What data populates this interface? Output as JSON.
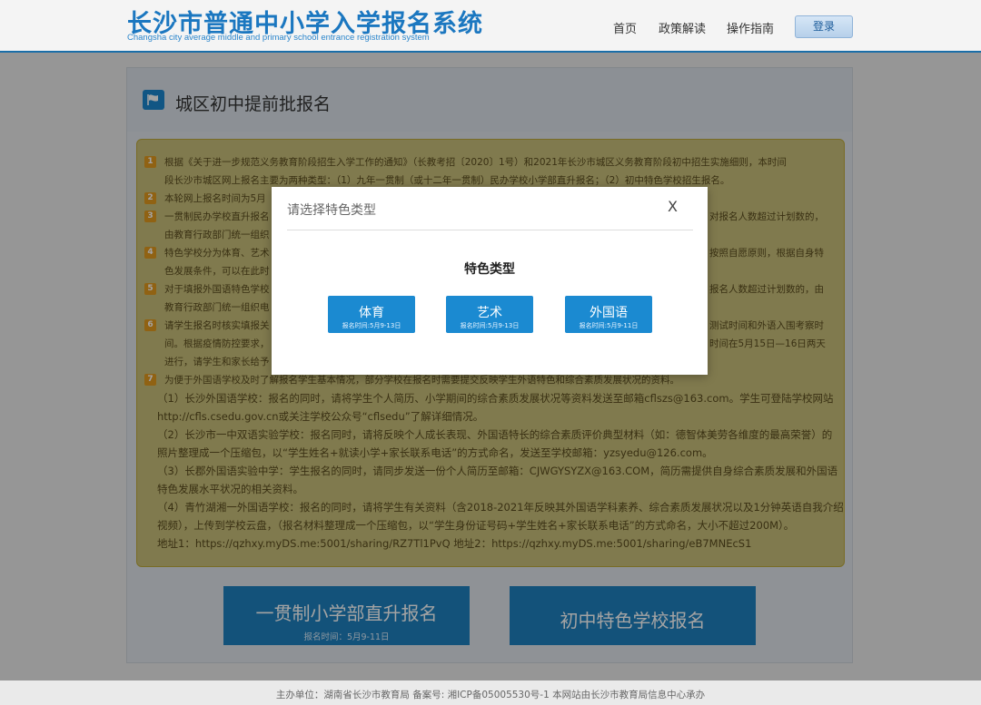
{
  "header": {
    "title": "长沙市普通中小学入学报名系统",
    "subtitle": "Changsha city average middle and primary school entrance registration system",
    "nav": [
      {
        "label": "首页"
      },
      {
        "label": "政策解读"
      },
      {
        "label": "操作指南"
      }
    ],
    "login_label": "登录"
  },
  "page": {
    "title": "城区初中提前批报名",
    "title_icon": "flag-icon"
  },
  "notice": {
    "lines": [
      {
        "num": "1",
        "text": "根据《关于进一步规范义务教育阶段招生入学工作的通知》（长教考招〔2020〕1号）和2021年长沙市城区义务教育阶段初中招生实施细则，本时间"
      },
      {
        "num": "",
        "text": "段长沙市城区网上报名主要为两种类型：（1）九年一贯制（或十二年一贯制）民办学校小学部直升报名；（2）初中特色学校招生报名。"
      },
      {
        "num": "2",
        "text": "本轮网上报名时间为5月"
      },
      {
        "num": "3",
        "text": "一贯制民办学校直升报名"
      },
      {
        "num": "",
        "text": "由教育行政部门统一组织"
      },
      {
        "num": "4",
        "text": "特色学校分为体育、艺术"
      },
      {
        "num": "",
        "text": "色发展条件，可以在此时"
      },
      {
        "num": "5",
        "text": "对于填报外国语特色学校"
      },
      {
        "num": "",
        "text": "教育行政部门统一组织电"
      },
      {
        "num": "6",
        "text": "请学生报名时核实填报关"
      },
      {
        "num": "",
        "text": "间。根据疫情防控要求，"
      },
      {
        "num": "",
        "text": "进行，请学生和家长给予"
      },
      {
        "num": "7",
        "text": "为便于外国语学校及时了解报名学生基本情况，部分学校在报名时需要提交反映学生外语特色和综合素质发展状况的资料。"
      },
      {
        "num": "",
        "text": "（1）长沙外国语学校：报名的同时，请将学生个人简历、小学期间的综合素质发展状况等资料发送至邮箱cflszs@163.com。学生可登陆学校网站"
      },
      {
        "num": "",
        "text": "http://cfls.csedu.gov.cn或关注学校公众号“cflsedu”了解详细情况。"
      },
      {
        "num": "",
        "text": "（2）长沙市一中双语实验学校：报名同时，请将反映个人成长表现、外国语特长的综合素质评价典型材料（如：德智体美劳各维度的最高荣誉）的"
      },
      {
        "num": "",
        "text": "照片整理成一个压缩包，以“学生姓名+就读小学+家长联系电话”的方式命名，发送至学校邮箱：yzsyedu@126.com。"
      },
      {
        "num": "",
        "text": "（3）长郡外国语实验中学：学生报名的同时，请同步发送一份个人简历至邮箱：CJWGYSYZX@163.COM，简历需提供自身综合素质发展和外国语"
      },
      {
        "num": "",
        "text": "特色发展水平状况的相关资料。"
      },
      {
        "num": "",
        "text": "（4）青竹湖湘一外国语学校：报名的同时，请将学生有关资料（含2018-2021年反映其外国语学科素养、综合素质发展状况以及1分钟英语自我介绍"
      },
      {
        "num": "",
        "text": "视频），上传到学校云盘，（报名材料整理成一个压缩包，以“学生身份证号码+学生姓名+家长联系电话”的方式命名，大小不超过200M）。"
      },
      {
        "num": "",
        "text": "地址1：https://qzhxy.myDS.me:5001/sharing/RZ7Tl1PvQ 地址2：https://qzhxy.myDS.me:5001/sharing/eB7MNEcS1"
      }
    ],
    "right_fragments": [
      "对报名人数超过计划数的，",
      "按照自愿原则，根据自身特",
      "报名人数超过计划数的，由",
      "测试时间和外语入围考察时",
      "时间在5月15日—16日两天"
    ]
  },
  "actions": {
    "btn1": {
      "label": "一贯制小学部直升报名",
      "sub": "报名时间：5月9-11日"
    },
    "btn2": {
      "label": "初中特色学校报名"
    }
  },
  "footer": {
    "text": "主办单位：湖南省长沙市教育局     备案号: 湘ICP备05005530号-1 本网站由长沙市教育局信息中心承办"
  },
  "modal": {
    "title": "请选择特色类型",
    "close": "X",
    "heading": "特色类型",
    "types": [
      {
        "label": "体育",
        "sub": "报名时间:5月9-13日"
      },
      {
        "label": "艺术",
        "sub": "报名时间:5月9-13日"
      },
      {
        "label": "外国语",
        "sub": "报名时间:5月9-11日"
      }
    ]
  }
}
